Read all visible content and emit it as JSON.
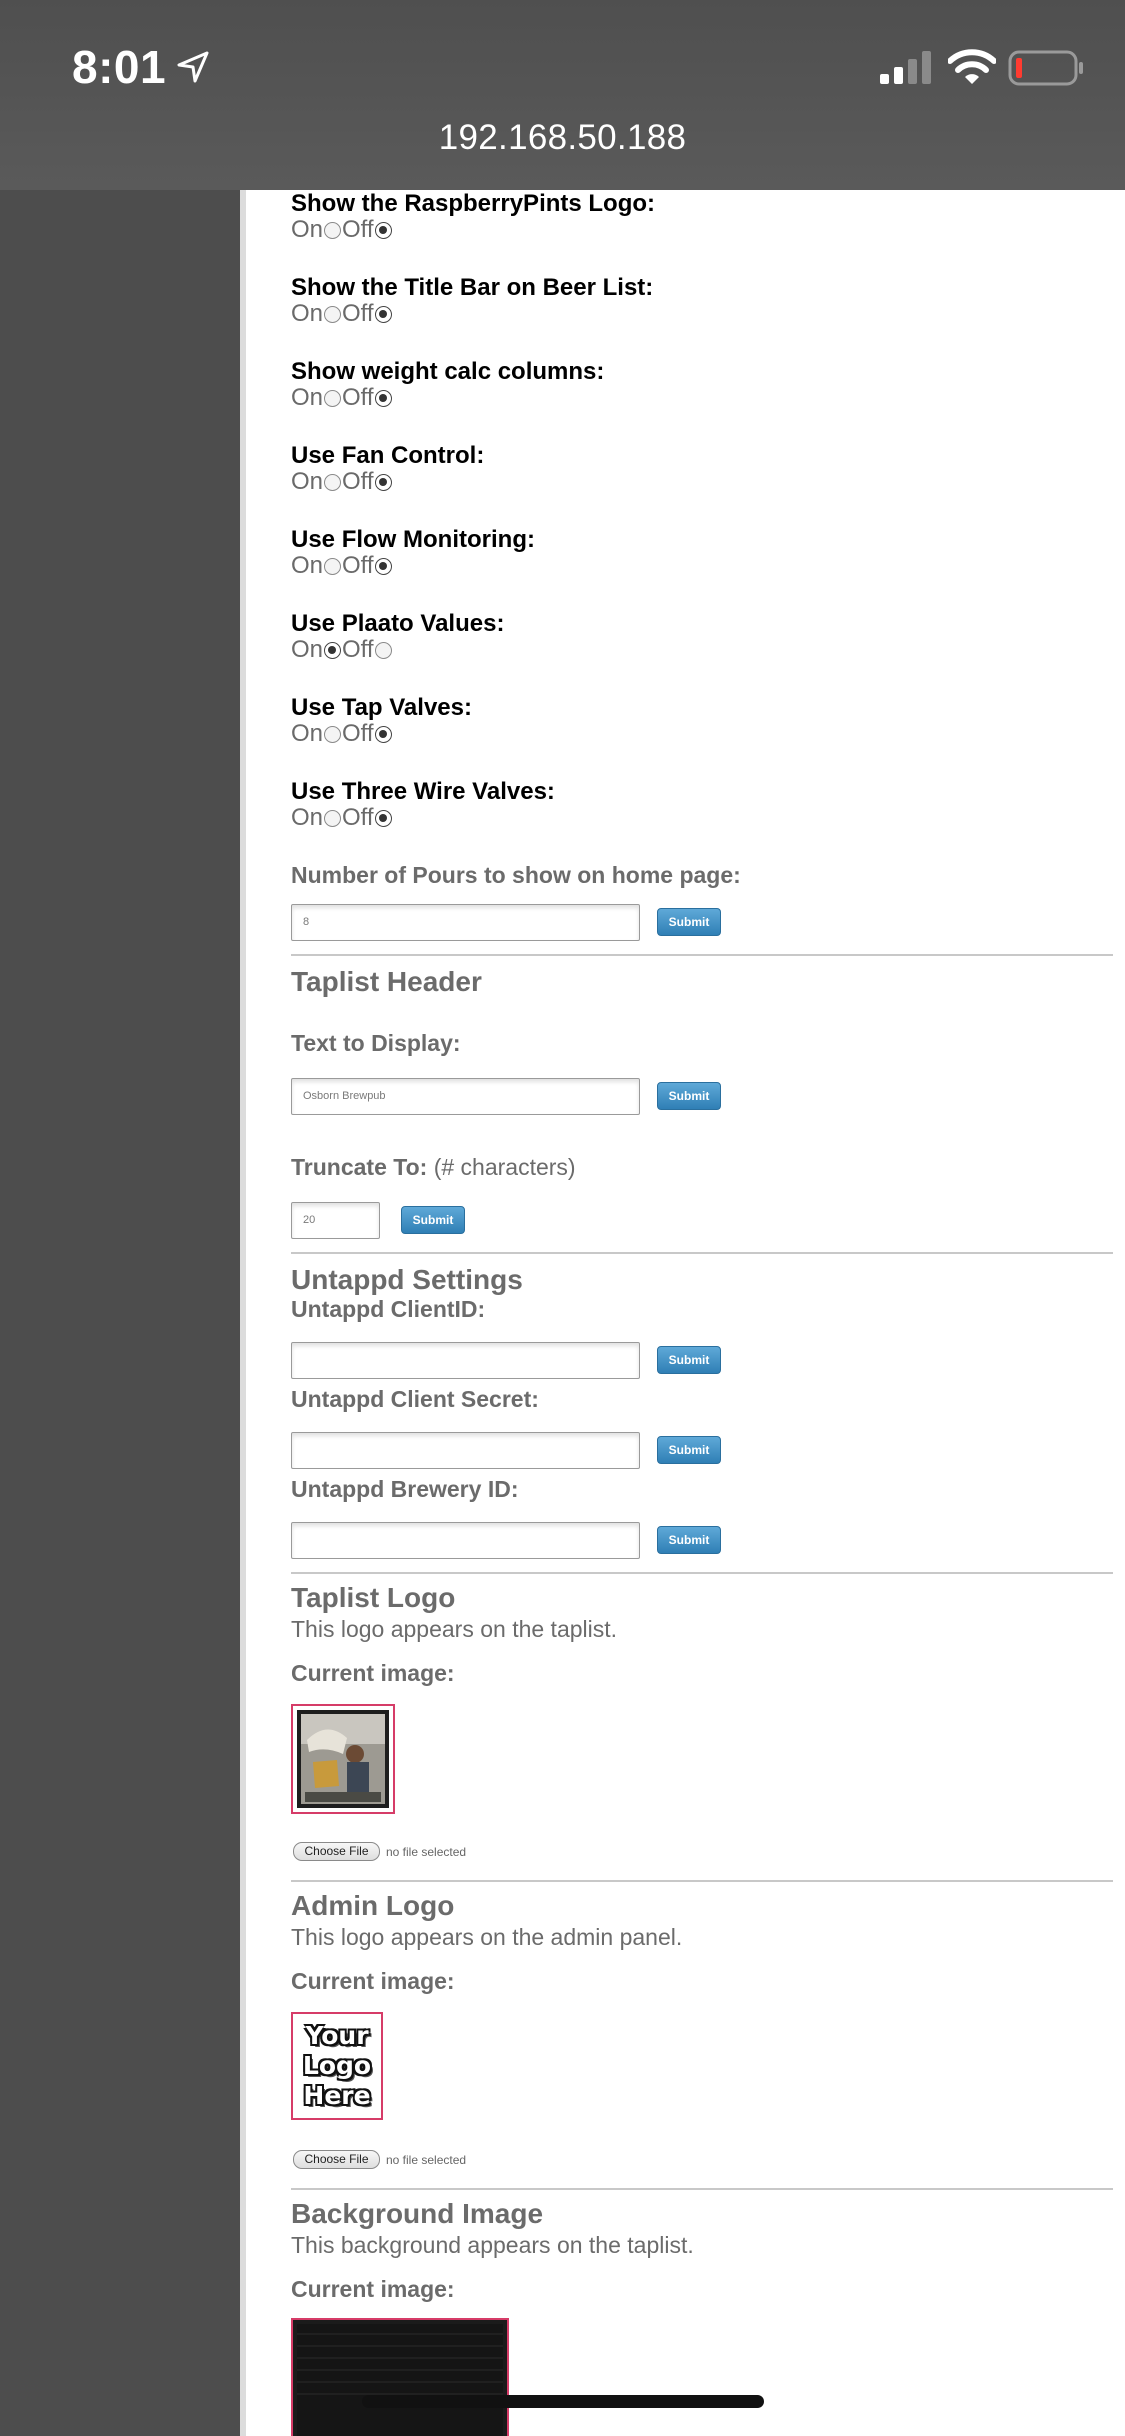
{
  "status_bar": {
    "time": "8:01",
    "url": "192.168.50.188",
    "icons": [
      "location-arrow-icon",
      "cellular-signal-icon",
      "wifi-icon",
      "battery-low-icon"
    ]
  },
  "options": [
    {
      "label": "Show the RaspberryPints Logo:",
      "on_label": "On",
      "off_label": "Off",
      "selected": "off"
    },
    {
      "label": "Show the Title Bar on Beer List:",
      "on_label": "On",
      "off_label": "Off",
      "selected": "off"
    },
    {
      "label": "Show weight calc columns:",
      "on_label": "On",
      "off_label": "Off",
      "selected": "off"
    },
    {
      "label": "Use Fan Control:",
      "on_label": "On",
      "off_label": "Off",
      "selected": "off"
    },
    {
      "label": "Use Flow Monitoring:",
      "on_label": "On",
      "off_label": "Off",
      "selected": "off"
    },
    {
      "label": "Use Plaato Values:",
      "on_label": "On",
      "off_label": "Off",
      "selected": "on"
    },
    {
      "label": "Use Tap Valves:",
      "on_label": "On",
      "off_label": "Off",
      "selected": "off"
    },
    {
      "label": "Use Three Wire Valves:",
      "on_label": "On",
      "off_label": "Off",
      "selected": "off"
    }
  ],
  "pours": {
    "label": "Number of Pours to show on home page:",
    "value": "8",
    "submit": "Submit"
  },
  "taplist_header": {
    "title": "Taplist Header",
    "text_label": "Text to Display:",
    "text_value": "Osborn Brewpub",
    "text_submit": "Submit",
    "truncate_label": "Truncate To:",
    "truncate_note": "(# characters)",
    "truncate_value": "20",
    "truncate_submit": "Submit"
  },
  "untappd": {
    "title": "Untappd Settings",
    "client_id_label": "Untappd ClientID:",
    "client_id_value": "",
    "client_id_submit": "Submit",
    "client_secret_label": "Untappd Client Secret:",
    "client_secret_value": "",
    "client_secret_submit": "Submit",
    "brewery_id_label": "Untappd Brewery ID:",
    "brewery_id_value": "",
    "brewery_id_submit": "Submit"
  },
  "taplist_logo": {
    "title": "Taplist Logo",
    "description": "This logo appears on the taplist.",
    "current_label": "Current image:",
    "choose_file": "Choose File",
    "file_status": "no file selected"
  },
  "admin_logo": {
    "title": "Admin Logo",
    "description": "This logo appears on the admin panel.",
    "current_label": "Current image:",
    "logo_text": [
      "Your",
      "Logo",
      "Here"
    ],
    "choose_file": "Choose File",
    "file_status": "no file selected"
  },
  "background_image": {
    "title": "Background Image",
    "description": "This background appears on the taplist.",
    "current_label": "Current image:"
  },
  "colors": {
    "submit_button": "#3b8fc6",
    "image_border": "#d63c68",
    "muted_text": "#6b6b6b"
  }
}
